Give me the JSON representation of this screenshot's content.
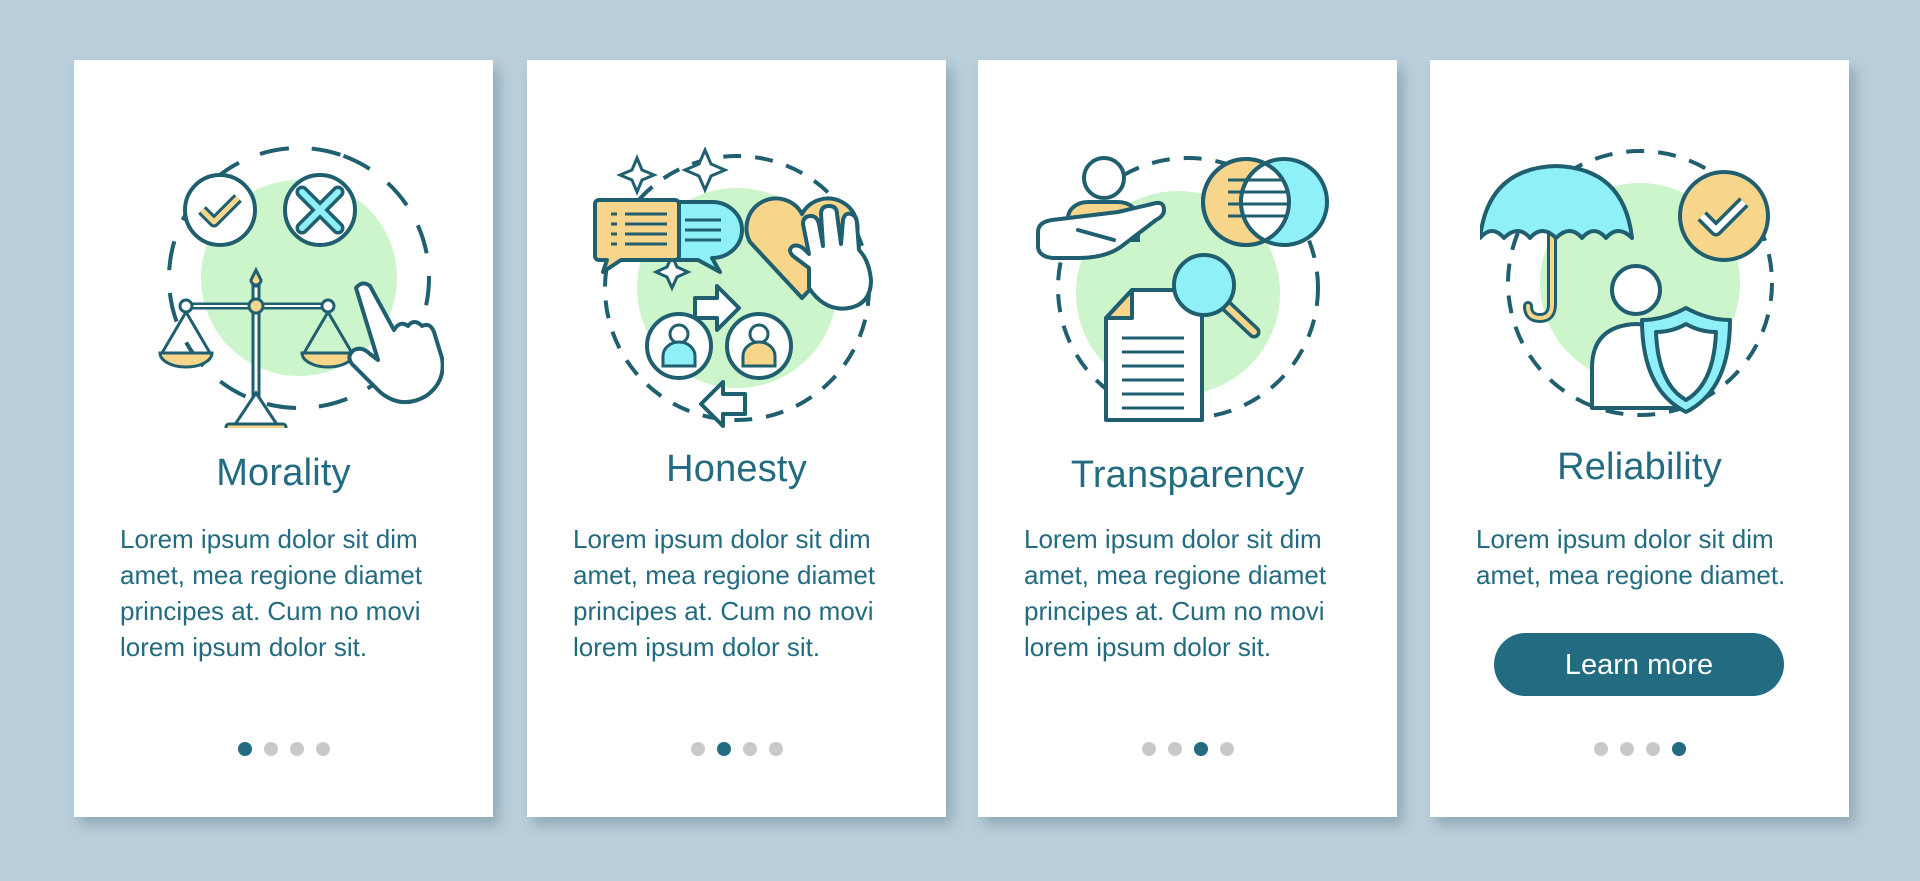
{
  "colors": {
    "background": "#b9cfdb",
    "card": "#ffffff",
    "accent": "#236b80",
    "dot_inactive": "#c9c9c9",
    "icon_stroke": "#1f5f70",
    "icon_yellow": "#f7d58a",
    "icon_cyan": "#8ff0fa",
    "icon_green_blob": "#cdf5cc"
  },
  "screens": [
    {
      "id": "morality",
      "icon": "scales-check-cross-hand-icon",
      "title": "Morality",
      "body": "Lorem ipsum dolor sit dim\namet, mea regione diamet\nprincipes at. Cum no movi\nlorem ipsum dolor sit.",
      "page_indicator": {
        "current": 1,
        "total": 4
      }
    },
    {
      "id": "honesty",
      "icon": "chat-heart-exchange-icon",
      "title": "Honesty",
      "body": "Lorem ipsum dolor sit dim\namet, mea regione diamet\nprincipes at. Cum no movi\nlorem ipsum dolor sit.",
      "page_indicator": {
        "current": 2,
        "total": 4
      }
    },
    {
      "id": "transparency",
      "icon": "document-magnifier-venn-icon",
      "title": "Transparency",
      "body": "Lorem ipsum dolor sit dim\namet, mea regione diamet\nprincipes at. Cum no movi\nlorem ipsum dolor sit.",
      "page_indicator": {
        "current": 3,
        "total": 4
      }
    },
    {
      "id": "reliability",
      "icon": "umbrella-shield-check-icon",
      "title": "Reliability",
      "body": "Lorem ipsum dolor sit dim\namet, mea regione diamet.",
      "button_label": "Learn more",
      "page_indicator": {
        "current": 4,
        "total": 4
      }
    }
  ]
}
